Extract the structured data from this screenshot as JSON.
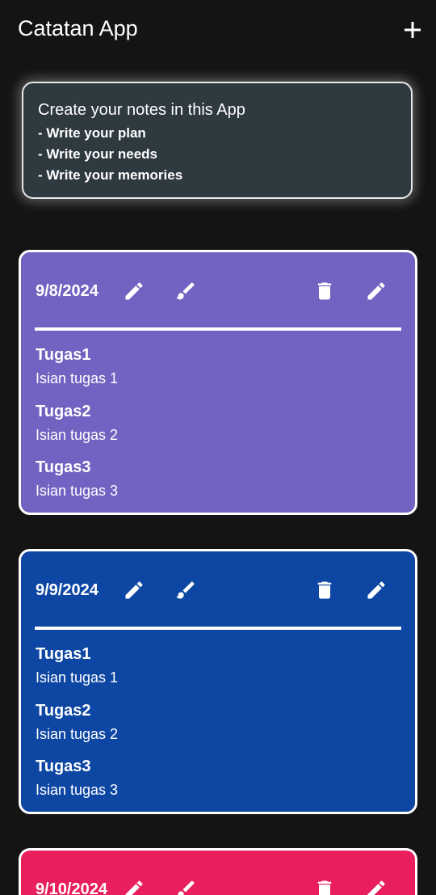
{
  "app": {
    "title": "Catatan App"
  },
  "icons": {
    "add": "plus-icon",
    "edit": "pencil-icon",
    "color": "brush-icon",
    "delete": "trash-icon"
  },
  "info": {
    "heading": "Create your notes in this App",
    "lines": [
      "- Write your plan",
      "- Write your needs",
      "- Write your memories"
    ]
  },
  "notes": [
    {
      "date": "9/8/2024",
      "color": "#7163c1",
      "items": [
        {
          "title": "Tugas1",
          "desc": "Isian tugas 1"
        },
        {
          "title": "Tugas2",
          "desc": "Isian tugas 2"
        },
        {
          "title": "Tugas3",
          "desc": "Isian tugas 3"
        }
      ]
    },
    {
      "date": "9/9/2024",
      "color": "#0e47a3",
      "items": [
        {
          "title": "Tugas1",
          "desc": "Isian tugas 1"
        },
        {
          "title": "Tugas2",
          "desc": "Isian tugas 2"
        },
        {
          "title": "Tugas3",
          "desc": "Isian tugas 3"
        }
      ]
    },
    {
      "date": "9/10/2024",
      "color": "#e91e5d",
      "items": []
    }
  ]
}
